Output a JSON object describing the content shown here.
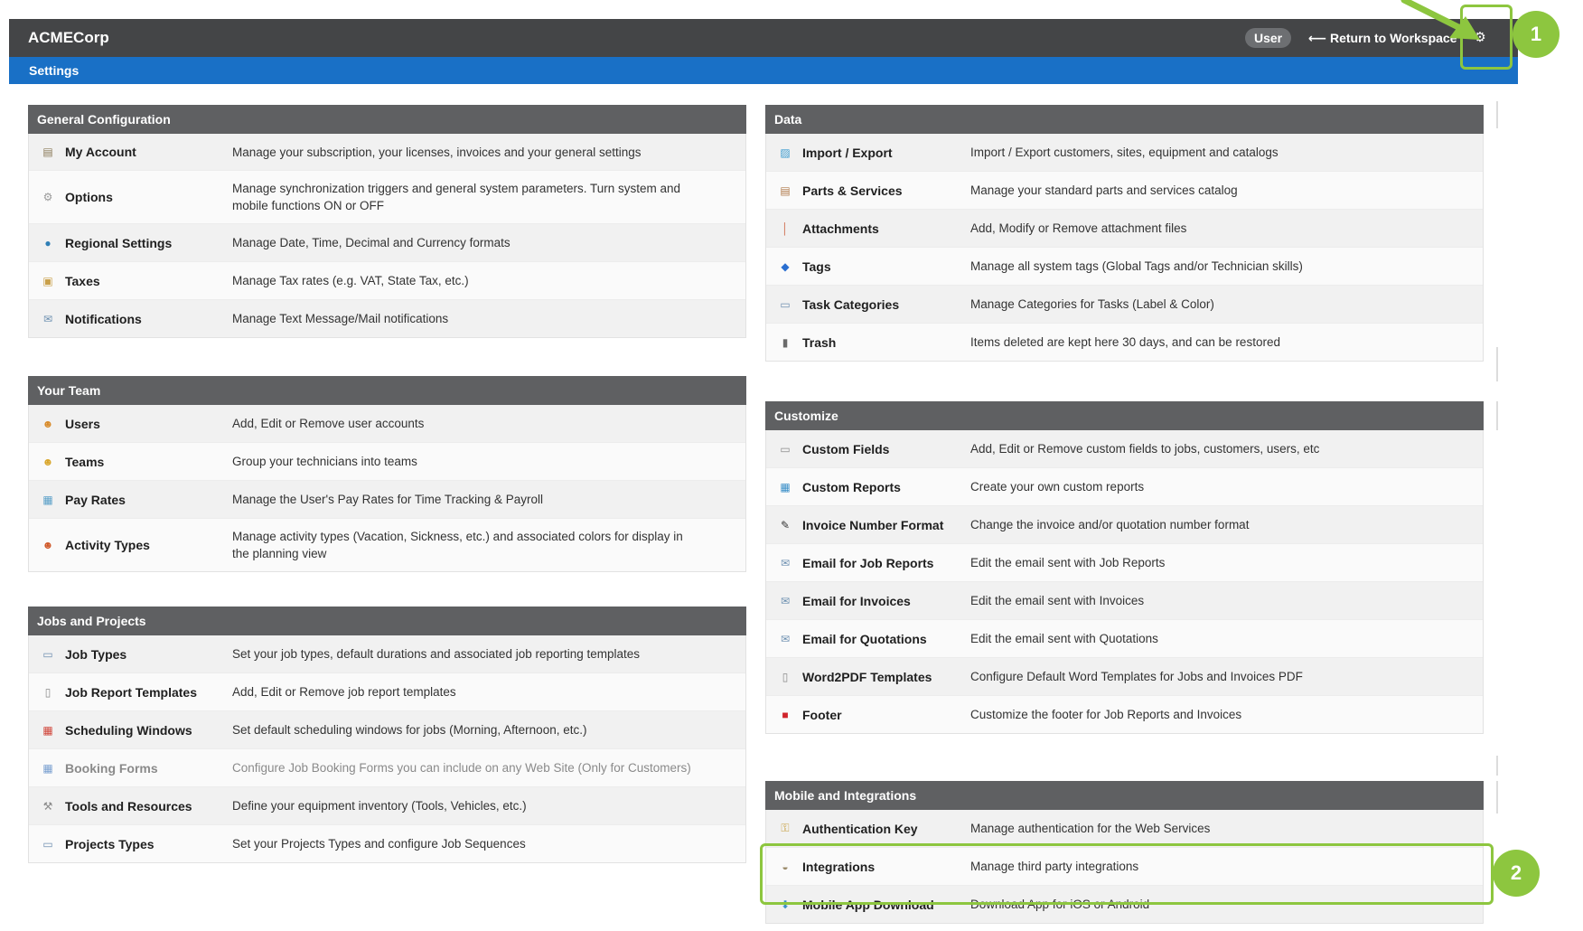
{
  "header": {
    "brand": "ACMECorp",
    "user_badge": "User",
    "return_link": "⟵ Return to Workspace",
    "gear_icon": "⚙"
  },
  "subheader": {
    "title": "Settings"
  },
  "panels": {
    "general": {
      "title": "General Configuration",
      "items": [
        {
          "name": "My Account",
          "desc": "Manage your subscription, your licenses, invoices and your general settings",
          "icon": "id-card-icon"
        },
        {
          "name": "Options",
          "desc": "Manage synchronization triggers and general system parameters. Turn system and mobile functions ON or OFF",
          "icon": "gear-icon"
        },
        {
          "name": "Regional Settings",
          "desc": "Manage Date, Time, Decimal and Currency formats",
          "icon": "globe-icon"
        },
        {
          "name": "Taxes",
          "desc": "Manage Tax rates (e.g. VAT, State Tax, etc.)",
          "icon": "tax-icon"
        },
        {
          "name": "Notifications",
          "desc": "Manage Text Message/Mail notifications",
          "icon": "envelope-icon"
        }
      ]
    },
    "team": {
      "title": "Your Team",
      "items": [
        {
          "name": "Users",
          "desc": "Add, Edit or Remove user accounts",
          "icon": "user-icon"
        },
        {
          "name": "Teams",
          "desc": "Group your technicians into teams",
          "icon": "team-icon"
        },
        {
          "name": "Pay Rates",
          "desc": "Manage the User's Pay Rates for Time Tracking & Payroll",
          "icon": "pay-rates-icon"
        },
        {
          "name": "Activity Types",
          "desc": "Manage activity types (Vacation, Sickness, etc.) and associated colors for display in the planning view",
          "icon": "activity-icon"
        }
      ]
    },
    "jobs": {
      "title": "Jobs and Projects",
      "items": [
        {
          "name": "Job Types",
          "desc": "Set your job types, default durations and associated job reporting templates",
          "icon": "window-icon"
        },
        {
          "name": "Job Report Templates",
          "desc": "Add, Edit or Remove job report templates",
          "icon": "document-icon"
        },
        {
          "name": "Scheduling Windows",
          "desc": "Set default scheduling windows for jobs (Morning, Afternoon, etc.)",
          "icon": "calendar-icon"
        },
        {
          "name": "Booking Forms",
          "desc": "Configure Job Booking Forms you can include on any Web Site (Only for Customers)",
          "icon": "form-icon"
        },
        {
          "name": "Tools and Resources",
          "desc": "Define your equipment inventory (Tools, Vehicles, etc.)",
          "icon": "wrench-icon"
        },
        {
          "name": "Projects Types",
          "desc": "Set your Projects Types and configure Job Sequences",
          "icon": "window-icon"
        }
      ]
    },
    "data": {
      "title": "Data",
      "items": [
        {
          "name": "Import / Export",
          "desc": "Import / Export customers, sites, equipment and catalogs",
          "icon": "import-export-icon"
        },
        {
          "name": "Parts & Services",
          "desc": "Manage your standard parts and services catalog",
          "icon": "clipboard-icon"
        },
        {
          "name": "Attachments",
          "desc": "Add, Modify or Remove attachment files",
          "icon": "paperclip-icon"
        },
        {
          "name": "Tags",
          "desc": "Manage all system tags (Global Tags and/or Technician skills)",
          "icon": "tag-icon"
        },
        {
          "name": "Task Categories",
          "desc": "Manage Categories for Tasks (Label & Color)",
          "icon": "window-icon"
        },
        {
          "name": "Trash",
          "desc": "Items deleted are kept here 30 days, and can be restored",
          "icon": "trash-icon"
        }
      ]
    },
    "customize": {
      "title": "Customize",
      "items": [
        {
          "name": "Custom Fields",
          "desc": "Add, Edit or Remove custom fields to jobs, customers, users, etc",
          "icon": "field-icon"
        },
        {
          "name": "Custom Reports",
          "desc": "Create your own custom reports",
          "icon": "report-icon"
        },
        {
          "name": "Invoice Number Format",
          "desc": "Change the invoice and/or quotation number format",
          "icon": "pencil-icon"
        },
        {
          "name": "Email for Job Reports",
          "desc": "Edit the email sent with Job Reports",
          "icon": "envelope-icon"
        },
        {
          "name": "Email for Invoices",
          "desc": "Edit the email sent with Invoices",
          "icon": "envelope-icon"
        },
        {
          "name": "Email for Quotations",
          "desc": "Edit the email sent with Quotations",
          "icon": "envelope-icon"
        },
        {
          "name": "Word2PDF Templates",
          "desc": "Configure Default Word Templates for Jobs and Invoices PDF",
          "icon": "document-icon"
        },
        {
          "name": "Footer",
          "desc": "Customize the footer for Job Reports and Invoices",
          "icon": "pdf-icon"
        }
      ]
    },
    "mobile": {
      "title": "Mobile and Integrations",
      "items": [
        {
          "name": "Authentication Key",
          "desc": "Manage authentication for the Web Services",
          "icon": "key-icon"
        },
        {
          "name": "Integrations",
          "desc": "Manage third party integrations",
          "icon": "puzzle-icon"
        },
        {
          "name": "Mobile App Download",
          "desc": "Download App for iOS or Android",
          "icon": "download-icon"
        }
      ]
    }
  },
  "callouts": {
    "one": "1",
    "two": "2"
  },
  "accent_color": "#8dc63f",
  "header_color": "#444547",
  "subheader_color": "#1970c6"
}
